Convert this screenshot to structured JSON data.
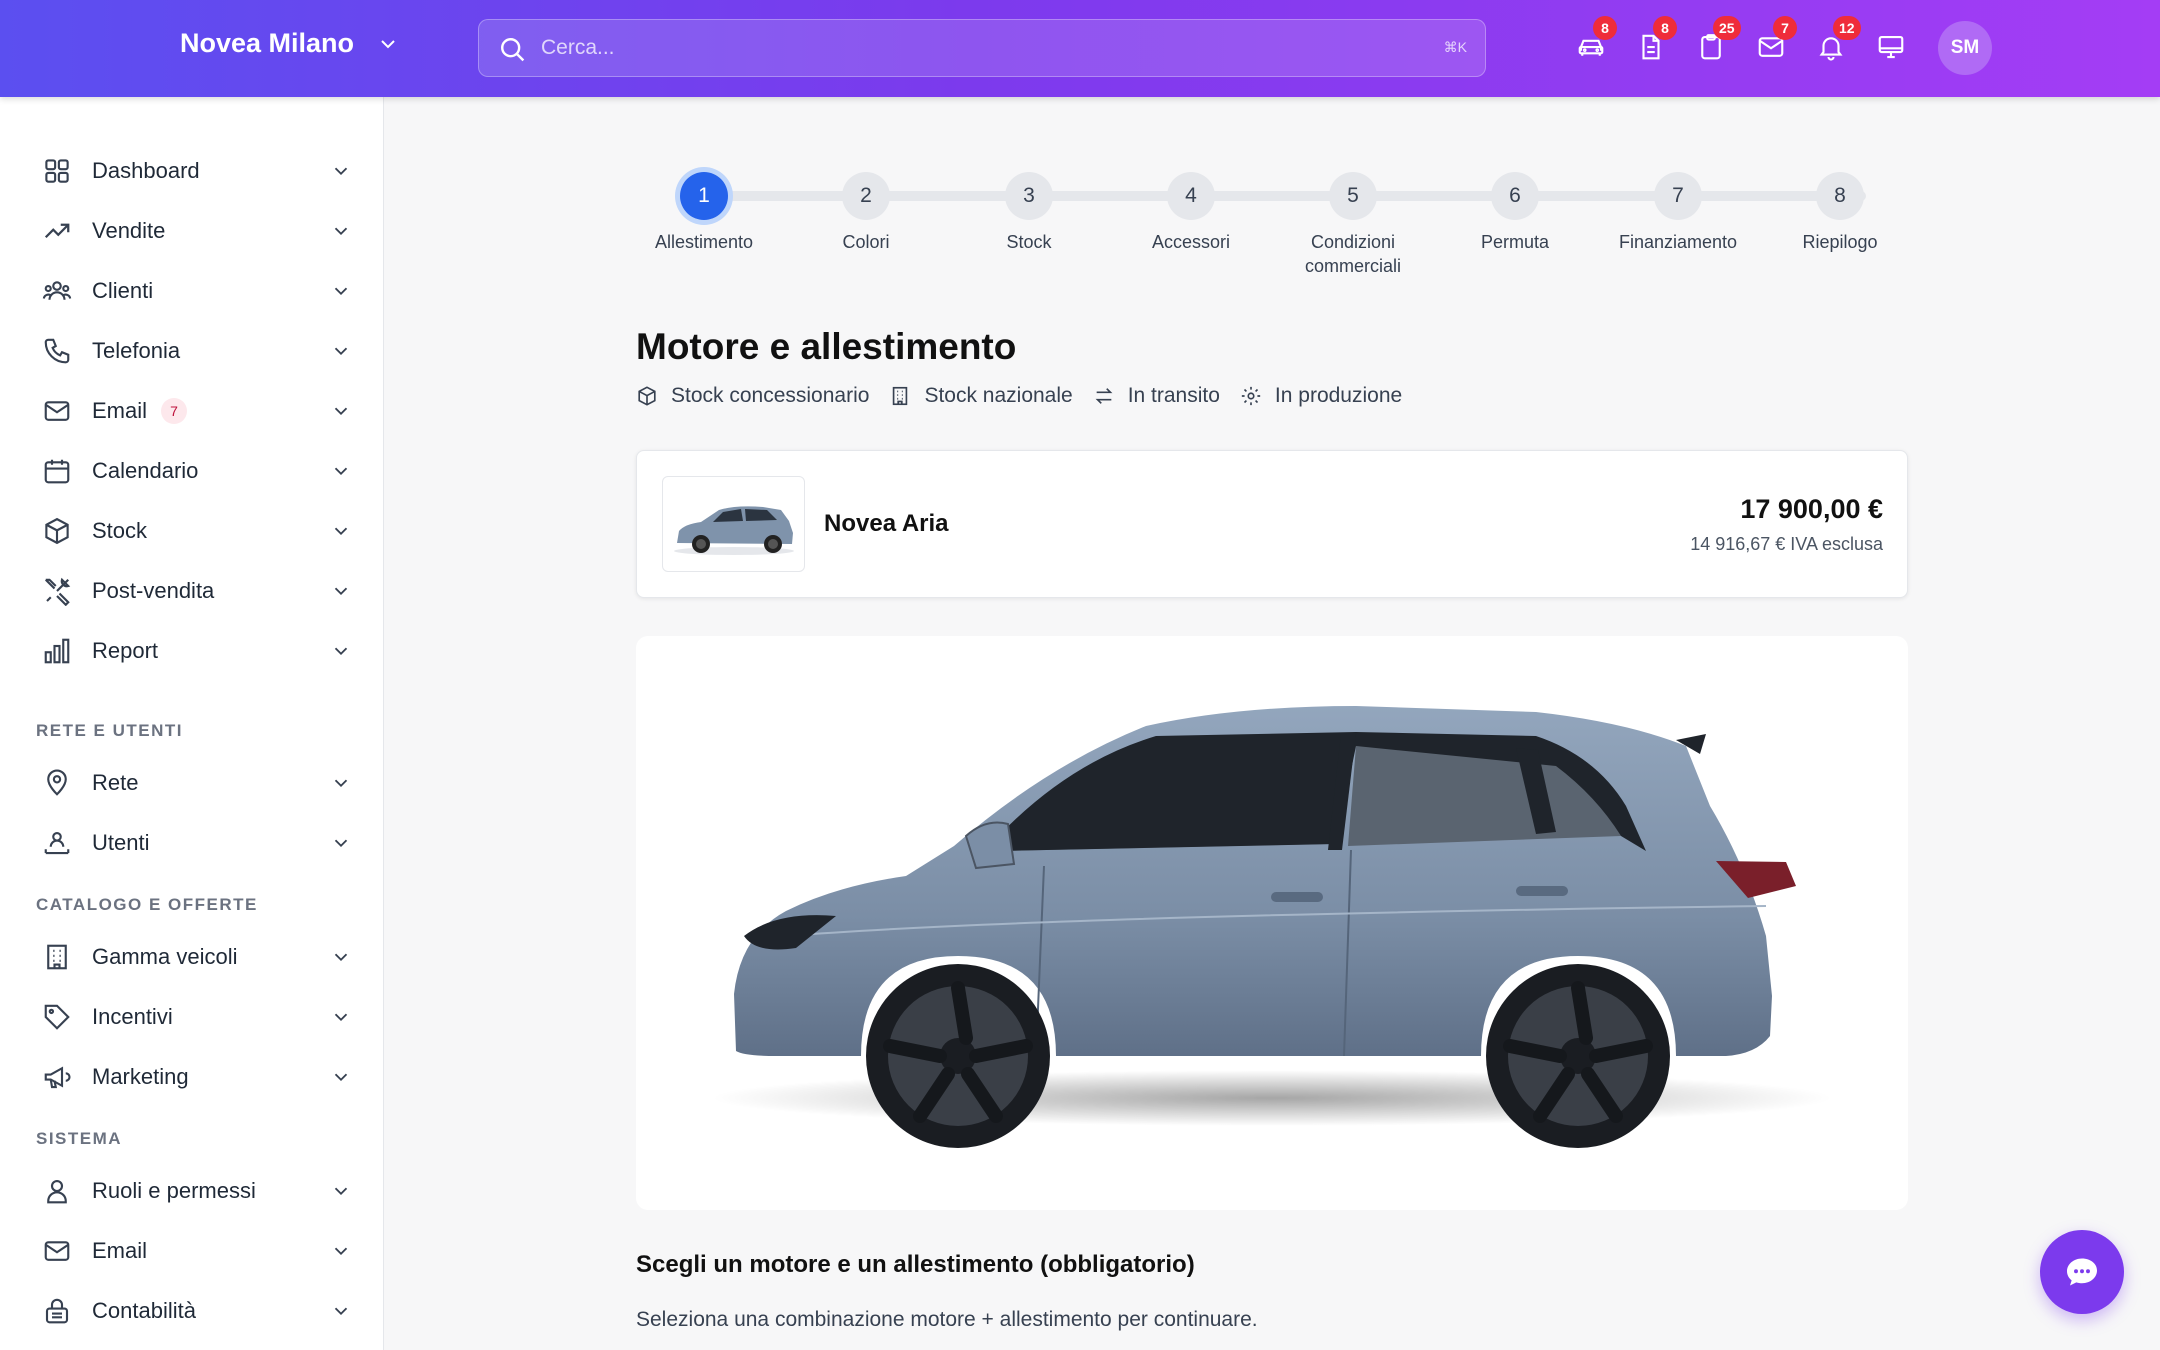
{
  "header": {
    "dealer_name": "Novea Milano",
    "search_placeholder": "Cerca...",
    "search_shortcut": "⌘K",
    "icons": [
      {
        "name": "car-icon",
        "badge": "8"
      },
      {
        "name": "document-icon",
        "badge": "8"
      },
      {
        "name": "clipboard-icon",
        "badge": "25"
      },
      {
        "name": "mail-icon",
        "badge": "7"
      },
      {
        "name": "bell-icon",
        "badge": "12"
      },
      {
        "name": "monitor-icon",
        "badge": ""
      }
    ],
    "avatar_initials": "SM"
  },
  "sidebar": {
    "main_items": [
      {
        "label": "Dashboard",
        "icon": "grid-icon"
      },
      {
        "label": "Vendite",
        "icon": "trending-up-icon"
      },
      {
        "label": "Clienti",
        "icon": "users-icon"
      },
      {
        "label": "Telefonia",
        "icon": "phone-icon"
      },
      {
        "label": "Email",
        "icon": "mail-icon",
        "badge": "7"
      },
      {
        "label": "Calendario",
        "icon": "calendar-icon"
      },
      {
        "label": "Stock",
        "icon": "cube-icon"
      },
      {
        "label": "Post-vendita",
        "icon": "tools-icon"
      },
      {
        "label": "Report",
        "icon": "bar-chart-icon"
      }
    ],
    "sections": [
      {
        "label": "RETE E UTENTI",
        "items": [
          {
            "label": "Rete",
            "icon": "map-pin-icon"
          },
          {
            "label": "Utenti",
            "icon": "user-network-icon"
          }
        ]
      },
      {
        "label": "CATALOGO E OFFERTE",
        "items": [
          {
            "label": "Gamma veicoli",
            "icon": "building-icon"
          },
          {
            "label": "Incentivi",
            "icon": "tag-icon"
          },
          {
            "label": "Marketing",
            "icon": "megaphone-icon"
          }
        ]
      },
      {
        "label": "SISTEMA",
        "items": [
          {
            "label": "Ruoli e permessi",
            "icon": "user-icon"
          },
          {
            "label": "Email",
            "icon": "mail-icon"
          },
          {
            "label": "Contabilità",
            "icon": "lock-icon"
          }
        ]
      }
    ]
  },
  "stepper": {
    "active_step": 1,
    "steps": [
      {
        "num": "1",
        "label": "Allestimento"
      },
      {
        "num": "2",
        "label": "Colori"
      },
      {
        "num": "3",
        "label": "Stock"
      },
      {
        "num": "4",
        "label": "Accessori"
      },
      {
        "num": "5",
        "label": "Condizioni commerciali"
      },
      {
        "num": "6",
        "label": "Permuta"
      },
      {
        "num": "7",
        "label": "Finanziamento"
      },
      {
        "num": "8",
        "label": "Riepilogo"
      }
    ]
  },
  "main": {
    "title": "Motore e allestimento",
    "filters": [
      {
        "label": "Stock concessionario",
        "icon": "cube-icon"
      },
      {
        "label": "Stock nazionale",
        "icon": "building-icon"
      },
      {
        "label": "In transito",
        "icon": "arrows-icon"
      },
      {
        "label": "In produzione",
        "icon": "gear-icon"
      }
    ],
    "vehicle": {
      "model": "Novea Aria",
      "price": "17 900,00 €",
      "price_net": "14 916,67 € IVA esclusa",
      "color": "#7f93ab"
    },
    "section_title": "Scegli un motore e un allestimento (obbligatorio)",
    "section_subtitle": "Seleziona una combinazione motore + allestimento per continuare."
  },
  "colors": {
    "accent": "#7c3aed",
    "step_active": "#2563eb",
    "badge": "#ef2c3a"
  }
}
